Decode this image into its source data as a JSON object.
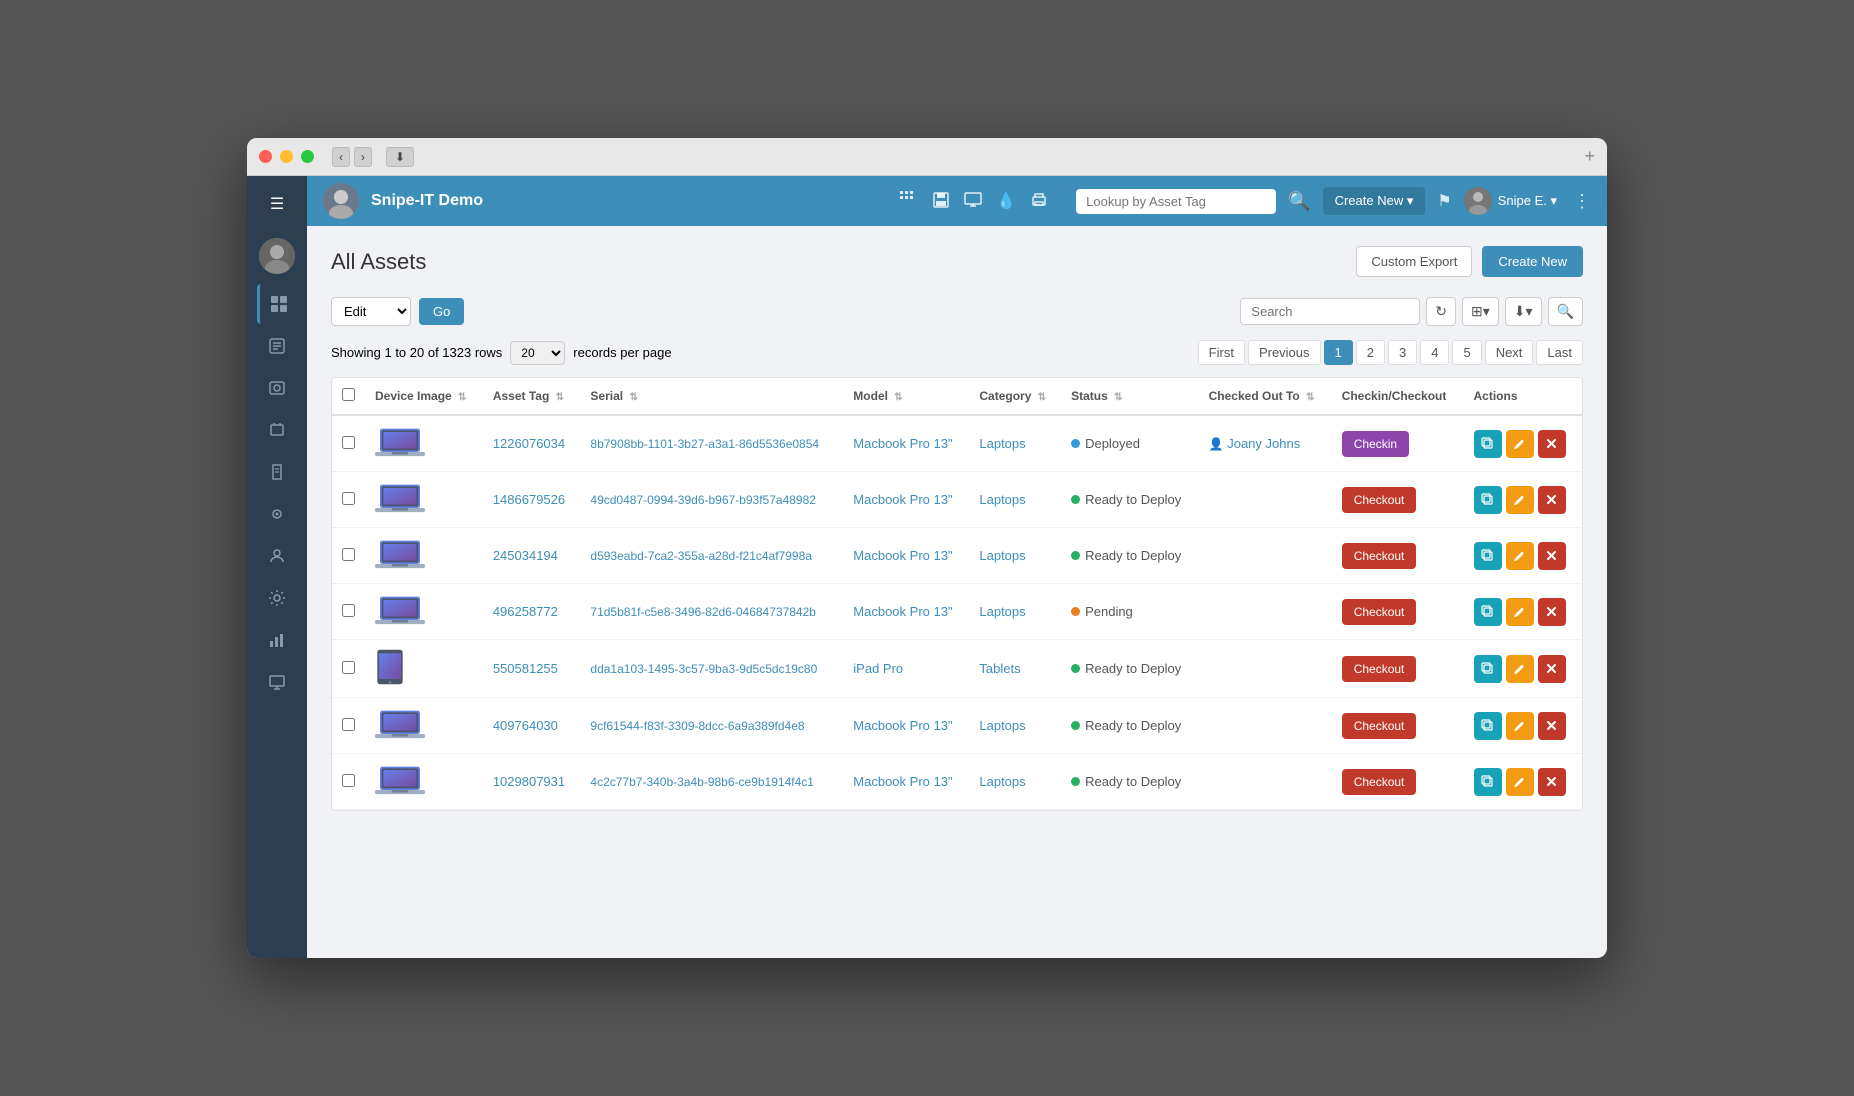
{
  "window": {
    "titlebar": {
      "nav_back": "‹",
      "nav_forward": "›",
      "download_icon": "⬇"
    }
  },
  "app": {
    "title": "Snipe-IT Demo",
    "topnav": {
      "search_placeholder": "Lookup by Asset Tag",
      "create_new_label": "Create New ▾",
      "flag_icon": "⚑",
      "user_name": "Snipe E. ▾",
      "share_icon": "⋮"
    },
    "sidebar": {
      "icons": [
        "☰",
        "👤",
        "▦",
        "◉",
        "⊞",
        "◈",
        "⚙",
        "📊",
        "🖥"
      ]
    }
  },
  "page": {
    "title": "All Assets",
    "custom_export_label": "Custom Export",
    "create_new_label": "Create New"
  },
  "toolbar": {
    "edit_label": "Edit",
    "go_label": "Go",
    "search_placeholder": "Search",
    "refresh_icon": "↻",
    "columns_icon": "⊞",
    "download_icon": "⬇",
    "search_icon": "🔍"
  },
  "pagination": {
    "showing_text": "Showing 1 to 20 of 1323 rows",
    "per_page": "20",
    "records_text": "records per page",
    "first_label": "First",
    "previous_label": "Previous",
    "pages": [
      "1",
      "2",
      "3",
      "4",
      "5"
    ],
    "active_page": "1",
    "next_label": "Next",
    "last_label": "Last"
  },
  "table": {
    "columns": [
      {
        "id": "checkbox",
        "label": ""
      },
      {
        "id": "device_image",
        "label": "Device Image"
      },
      {
        "id": "asset_tag",
        "label": "Asset Tag"
      },
      {
        "id": "serial",
        "label": "Serial"
      },
      {
        "id": "model",
        "label": "Model"
      },
      {
        "id": "category",
        "label": "Category"
      },
      {
        "id": "status",
        "label": "Status"
      },
      {
        "id": "checked_out_to",
        "label": "Checked Out To"
      },
      {
        "id": "checkin_checkout",
        "label": "Checkin/Checkout"
      },
      {
        "id": "actions",
        "label": "Actions"
      }
    ],
    "rows": [
      {
        "asset_tag": "1226076034",
        "serial": "8b7908bb-1101-3b27-a3a1-86d5536e0854",
        "model": "Macbook Pro 13\"",
        "category": "Laptops",
        "status": "Deployed",
        "status_type": "deployed",
        "checked_out_to": "Joany Johns",
        "action_type": "checkin",
        "device_type": "laptop"
      },
      {
        "asset_tag": "1486679526",
        "serial": "49cd0487-0994-39d6-b967-b93f57a48982",
        "model": "Macbook Pro 13\"",
        "category": "Laptops",
        "status": "Ready to Deploy",
        "status_type": "ready",
        "checked_out_to": "",
        "action_type": "checkout",
        "device_type": "laptop"
      },
      {
        "asset_tag": "245034194",
        "serial": "d593eabd-7ca2-355a-a28d-f21c4af7998a",
        "model": "Macbook Pro 13\"",
        "category": "Laptops",
        "status": "Ready to Deploy",
        "status_type": "ready",
        "checked_out_to": "",
        "action_type": "checkout",
        "device_type": "laptop"
      },
      {
        "asset_tag": "496258772",
        "serial": "71d5b81f-c5e8-3496-82d6-04684737842b",
        "model": "Macbook Pro 13\"",
        "category": "Laptops",
        "status": "Pending",
        "status_type": "pending",
        "checked_out_to": "",
        "action_type": "checkout",
        "device_type": "laptop"
      },
      {
        "asset_tag": "550581255",
        "serial": "dda1a103-1495-3c57-9ba3-9d5c5dc19c80",
        "model": "iPad Pro",
        "category": "Tablets",
        "status": "Ready to Deploy",
        "status_type": "ready",
        "checked_out_to": "",
        "action_type": "checkout",
        "device_type": "tablet"
      },
      {
        "asset_tag": "409764030",
        "serial": "9cf61544-f83f-3309-8dcc-6a9a389fd4e8",
        "model": "Macbook Pro 13\"",
        "category": "Laptops",
        "status": "Ready to Deploy",
        "status_type": "ready",
        "checked_out_to": "",
        "action_type": "checkout",
        "device_type": "laptop"
      },
      {
        "asset_tag": "1029807931",
        "serial": "4c2c77b7-340b-3a4b-98b6-ce9b1914f4c1",
        "model": "Macbook Pro 13\"",
        "category": "Laptops",
        "status": "Ready to Deploy",
        "status_type": "ready",
        "checked_out_to": "",
        "action_type": "checkout",
        "device_type": "laptop"
      }
    ]
  },
  "colors": {
    "primary": "#3d8eb9",
    "checkin_bg": "#8e44ad",
    "checkout_bg": "#c0392b",
    "sidebar_bg": "#2c3e50",
    "topnav_bg": "#3d8eb9"
  }
}
